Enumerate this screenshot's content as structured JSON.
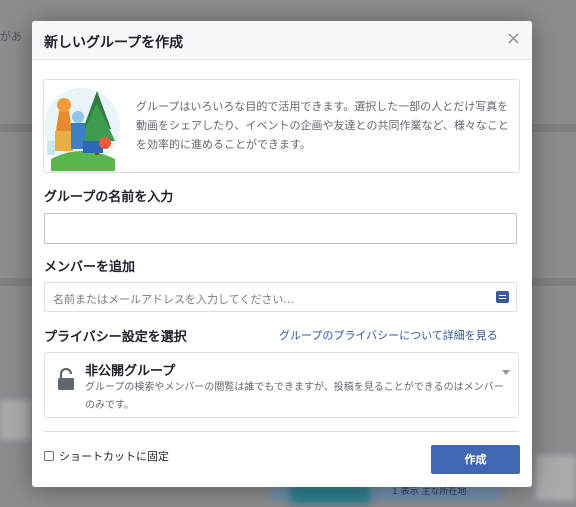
{
  "background": {
    "partial_text": "があ",
    "footnote_text": "1 表示 主な所在地"
  },
  "dialog": {
    "title": "新しいグループを作成",
    "close_icon": "close-icon",
    "intro_text": "グループはいろいろな目的で活用できます。選択した一部の人とだけ写真を動画をシェアしたり、イベントの企画や友達との共同作業など、様々なことを効率的に進めることができます。",
    "name_label": "グループの名前を入力",
    "name_value": "",
    "members_label": "メンバーを追加",
    "members_placeholder": "名前またはメールアドレスを入力してください...",
    "privacy_label": "プライバシー設定を選択",
    "privacy_link": "グループのプライバシーについて詳細を見る",
    "privacy_option": {
      "title": "非公開グループ",
      "description": "グループの検索やメンバーの閲覧は誰でもできますが、投稿を見ることができるのはメンバーのみです。",
      "icon": "lock-icon"
    },
    "shortcut_label": "ショートカットに固定",
    "shortcut_checked": false,
    "create_button": "作成"
  },
  "colors": {
    "accent": "#4267b2",
    "link": "#365899",
    "overlay": "#7f8186"
  }
}
